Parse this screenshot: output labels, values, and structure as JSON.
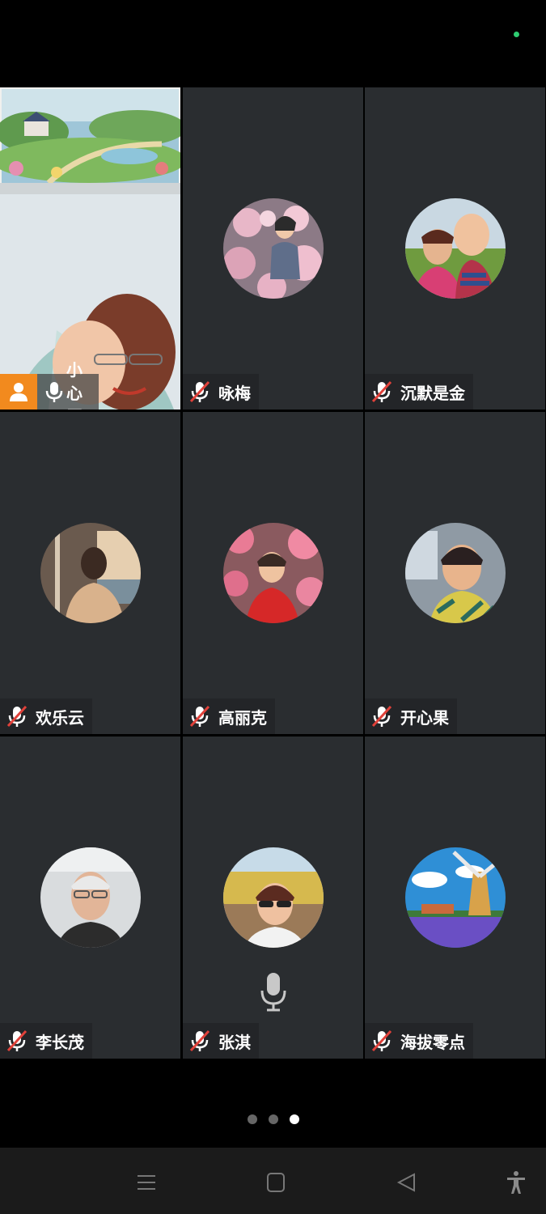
{
  "participants": [
    {
      "name": "小心愿",
      "role": "host",
      "mic": "on",
      "video": true
    },
    {
      "name": "咏梅",
      "mic": "muted"
    },
    {
      "name": "沉默是金",
      "mic": "muted"
    },
    {
      "name": "欢乐云",
      "mic": "muted"
    },
    {
      "name": "高丽克",
      "mic": "muted"
    },
    {
      "name": "开心果",
      "mic": "muted"
    },
    {
      "name": "李长茂",
      "mic": "muted"
    },
    {
      "name": "张淇",
      "mic": "muted"
    },
    {
      "name": "海拔零点",
      "mic": "muted"
    }
  ],
  "pager": {
    "pages": 3,
    "current": 3
  },
  "colors": {
    "host_badge": "#f28a1e",
    "tile_bg": "#2a2d30",
    "muted_slash": "#e0413a"
  },
  "icons": [
    "person-icon",
    "microphone-icon",
    "muted-microphone-icon",
    "menu-icon",
    "home-square-icon",
    "back-triangle-icon",
    "accessibility-icon"
  ]
}
